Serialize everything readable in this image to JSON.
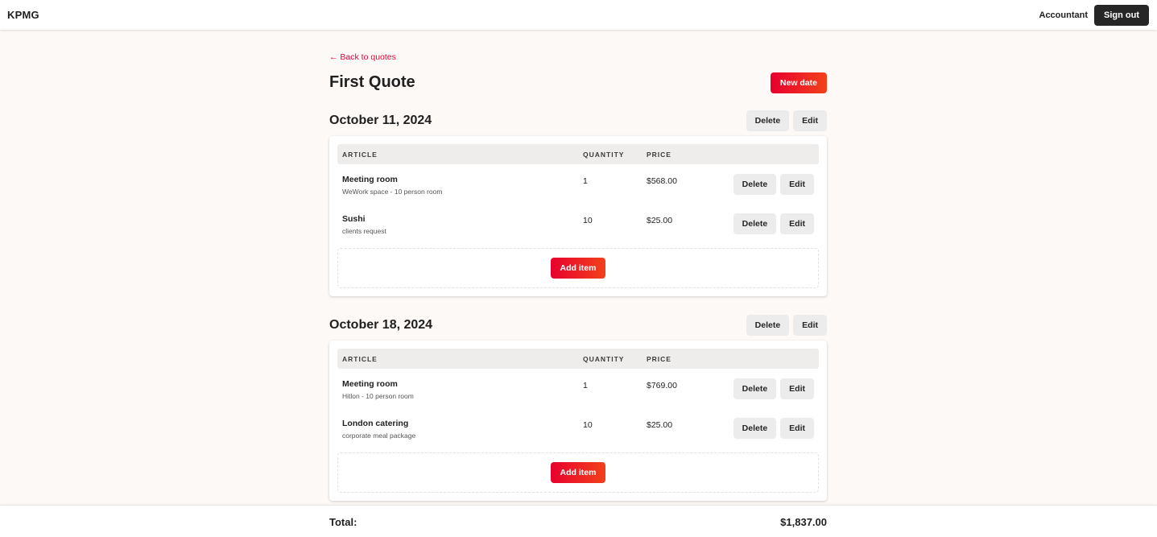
{
  "navbar": {
    "brand": "KPMG",
    "role": "Accountant",
    "sign_out_label": "Sign out"
  },
  "page": {
    "back_label": "← Back to quotes",
    "title": "First Quote",
    "new_date_label": "New date"
  },
  "table_headers": {
    "article": "ARTICLE",
    "quantity": "QUANTITY",
    "price": "PRICE"
  },
  "labels": {
    "delete": "Delete",
    "edit": "Edit",
    "add_item": "Add item"
  },
  "dates": [
    {
      "title": "October 11, 2024",
      "items": [
        {
          "name": "Meeting room",
          "description": "WeWork space - 10 person room",
          "quantity": "1",
          "price": "$568.00"
        },
        {
          "name": "Sushi",
          "description": "clients request",
          "quantity": "10",
          "price": "$25.00"
        }
      ]
    },
    {
      "title": "October 18, 2024",
      "items": [
        {
          "name": "Meeting room",
          "description": "Hitlon - 10 person room",
          "quantity": "1",
          "price": "$769.00"
        },
        {
          "name": "London catering",
          "description": "corporate meal package",
          "quantity": "10",
          "price": "$25.00"
        }
      ]
    }
  ],
  "footer": {
    "total_label": "Total:",
    "total_value": "$1,837.00"
  },
  "colors": {
    "accent_start": "#e8002e",
    "accent_end": "#f2411b",
    "link": "#e0043a",
    "dark_button": "#262626"
  }
}
